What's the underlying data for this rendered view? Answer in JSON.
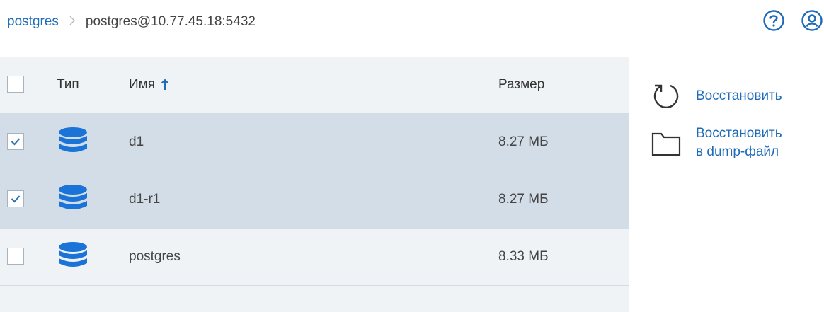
{
  "breadcrumb": {
    "root": "postgres",
    "separator": ">",
    "current": "postgres@10.77.45.18:5432"
  },
  "toolbar": {
    "help_icon": "question-circle-icon",
    "account_icon": "user-circle-icon"
  },
  "table": {
    "columns": {
      "type": "Тип",
      "name": "Имя",
      "size": "Размер"
    },
    "sort": {
      "column": "name",
      "direction": "ascending"
    },
    "rows": [
      {
        "checked": true,
        "icon": "database-icon",
        "name": "d1",
        "size": "8.27 МБ"
      },
      {
        "checked": true,
        "icon": "database-icon",
        "name": "d1-r1",
        "size": "8.27 МБ"
      },
      {
        "checked": false,
        "icon": "database-icon",
        "name": "postgres",
        "size": "8.33 МБ"
      }
    ]
  },
  "actions": {
    "restore": {
      "label": "Восстановить",
      "icon": "restore-icon"
    },
    "restore_dump": {
      "label_line1": "Восстановить",
      "label_line2": "в dump-файл",
      "icon": "folder-icon"
    }
  },
  "colors": {
    "accent": "#1e6bb8",
    "selected_row": "#d3dde8",
    "table_bg": "#f0f3f6",
    "db_icon": "#1a73d6"
  }
}
